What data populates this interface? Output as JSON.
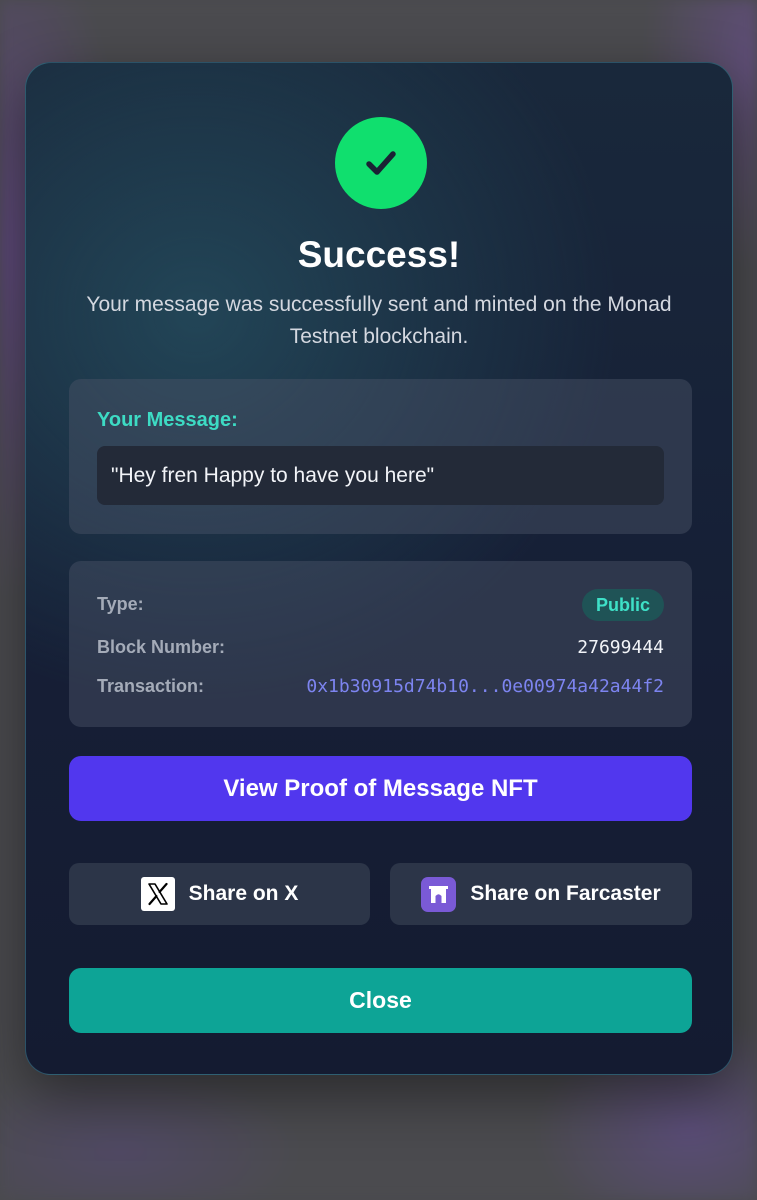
{
  "header": {
    "title": "Success!",
    "subtitle": "Your message was successfully sent and minted on the Monad Testnet blockchain.",
    "icon": "check-icon",
    "accent_color": "#10df6e"
  },
  "message": {
    "label": "Your Message:",
    "text": "\"Hey fren Happy to have you here\""
  },
  "details": {
    "type_label": "Type:",
    "type_value": "Public",
    "block_label": "Block Number:",
    "block_value": "27699444",
    "tx_label": "Transaction:",
    "tx_value": "0x1b30915d74b10...0e00974a42a44f2"
  },
  "actions": {
    "view_nft": "View Proof of Message NFT",
    "share_x": "Share on X",
    "share_farcaster": "Share on Farcaster",
    "close": "Close"
  },
  "colors": {
    "primary_button": "#5137ee",
    "close_button": "#0da496",
    "label_accent": "#3ddbc4",
    "transaction_link": "#7d84f0"
  }
}
